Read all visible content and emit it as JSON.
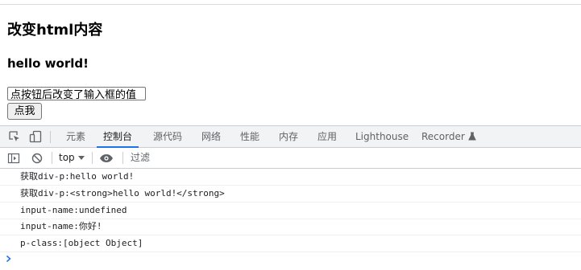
{
  "page": {
    "heading": "改变html内容",
    "strong_text": "hello world!",
    "input_value": "点按钮后改变了输入框的值",
    "button_label": "点我"
  },
  "devtools": {
    "tabs": [
      {
        "label": "元素",
        "active": false
      },
      {
        "label": "控制台",
        "active": true
      },
      {
        "label": "源代码",
        "active": false
      },
      {
        "label": "网络",
        "active": false
      },
      {
        "label": "性能",
        "active": false
      },
      {
        "label": "内存",
        "active": false
      },
      {
        "label": "应用",
        "active": false
      },
      {
        "label": "Lighthouse",
        "active": false
      },
      {
        "label": "Recorder",
        "active": false
      }
    ],
    "toolbar": {
      "context": "top",
      "filter_placeholder": "过滤"
    },
    "console_lines": [
      "获取div-p:hello world!",
      "获取div-p:<strong>hello world!</strong>",
      "input-name:undefined",
      "input-name:你好!",
      "p-class:[object Object]"
    ]
  },
  "colors": {
    "accent": "#1a73e8",
    "toolbar_bg": "#f1f3f4",
    "icon": "#5f6368"
  }
}
